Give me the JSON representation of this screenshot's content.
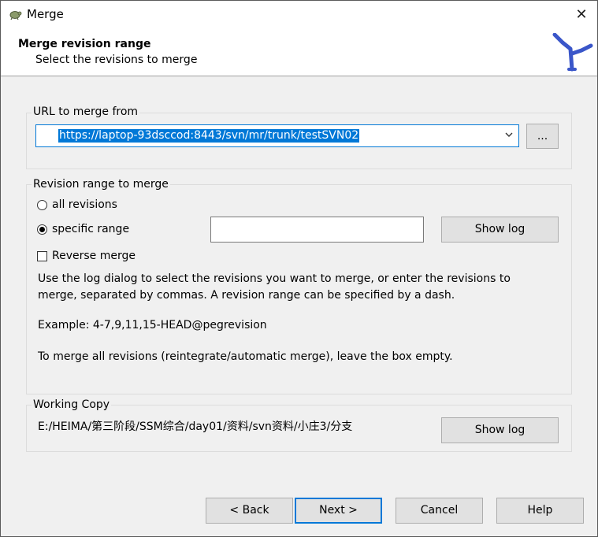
{
  "window": {
    "title": "Merge",
    "close_glyph": "✕"
  },
  "header": {
    "title": "Merge revision range",
    "subtitle": "Select the revisions to merge",
    "logo_icon": "tortoisesvn-merge-logo"
  },
  "url_group": {
    "label": "URL to merge from",
    "url_value": "https://laptop-93dsccod:8443/svn/mr/trunk/testSVN02",
    "browse_label": "..."
  },
  "range_group": {
    "label": "Revision range to merge",
    "all_revisions_label": "all revisions",
    "specific_range_label": "specific range",
    "selected_option": "specific range",
    "range_value": "",
    "show_log_label": "Show log",
    "reverse_merge_label": "Reverse merge",
    "reverse_merge_checked": false,
    "help_line1": "Use the log dialog to select the revisions you want to merge, or enter the revisions to",
    "help_line2": "merge, separated by commas. A revision range can be specified by a dash.",
    "example": "Example: 4-7,9,11,15-HEAD@pegrevision",
    "all_note": "To merge all revisions (reintegrate/automatic merge), leave the box empty."
  },
  "working_copy": {
    "label": "Working Copy",
    "path": "E:/HEIMA/第三阶段/SSM综合/day01/资料/svn资料/小庄3/分支",
    "show_log_label": "Show log"
  },
  "footer": {
    "back_label": "< Back",
    "next_label": "Next >",
    "cancel_label": "Cancel",
    "help_label": "Help"
  },
  "colors": {
    "accent": "#0078d7",
    "logo": "#3a56c9",
    "dialog_bg": "#f0f0f0"
  }
}
